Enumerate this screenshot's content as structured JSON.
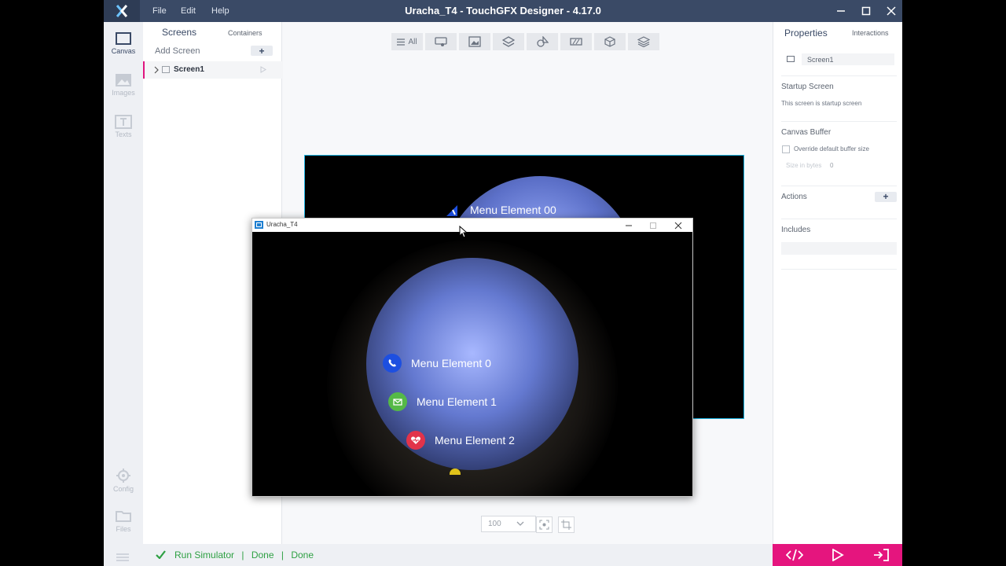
{
  "app": {
    "title": "Uracha_T4 - TouchGFX Designer - 4.17.0",
    "menu": [
      "File",
      "Edit",
      "Help"
    ]
  },
  "rail": {
    "items": [
      {
        "label": "Canvas",
        "icon": "canvas-icon"
      },
      {
        "label": "Images",
        "icon": "image-icon"
      },
      {
        "label": "Texts",
        "icon": "text-icon"
      },
      {
        "label": "Config",
        "icon": "gear-icon"
      },
      {
        "label": "Files",
        "icon": "folder-icon"
      }
    ]
  },
  "screens_panel": {
    "tabs": [
      "Screens",
      "Containers"
    ],
    "add_screen_label": "Add Screen",
    "add_button": "+",
    "items": [
      "Screen1"
    ]
  },
  "toolbar": {
    "all_label": "All"
  },
  "canvas": {
    "menu_label": "Menu Element 00",
    "zoom_value": "100"
  },
  "properties": {
    "tabs": [
      "Properties",
      "Interactions"
    ],
    "screen_name": "Screen1",
    "startup_title": "Startup Screen",
    "startup_text": "This screen is startup screen",
    "canvas_buffer_title": "Canvas Buffer",
    "override_label": "Override default buffer size",
    "size_label": "Size in bytes",
    "size_value": "0",
    "actions_title": "Actions",
    "actions_add": "+",
    "includes_title": "Includes"
  },
  "status": {
    "run_label": "Run Simulator",
    "sep": "|",
    "done1": "Done",
    "done2": "Done"
  },
  "simulator": {
    "title": "Uracha_T4",
    "menu_items": [
      "Menu Element 0",
      "Menu Element 1",
      "Menu Element 2"
    ]
  },
  "colors": {
    "accent": "#e5157e",
    "titlebar": "#3a4a66",
    "canvas_border": "#1fb7e6",
    "success": "#2ea043",
    "icon_phone": "#1d4fe0",
    "icon_mail": "#55b947",
    "icon_heart": "#e2334a"
  }
}
